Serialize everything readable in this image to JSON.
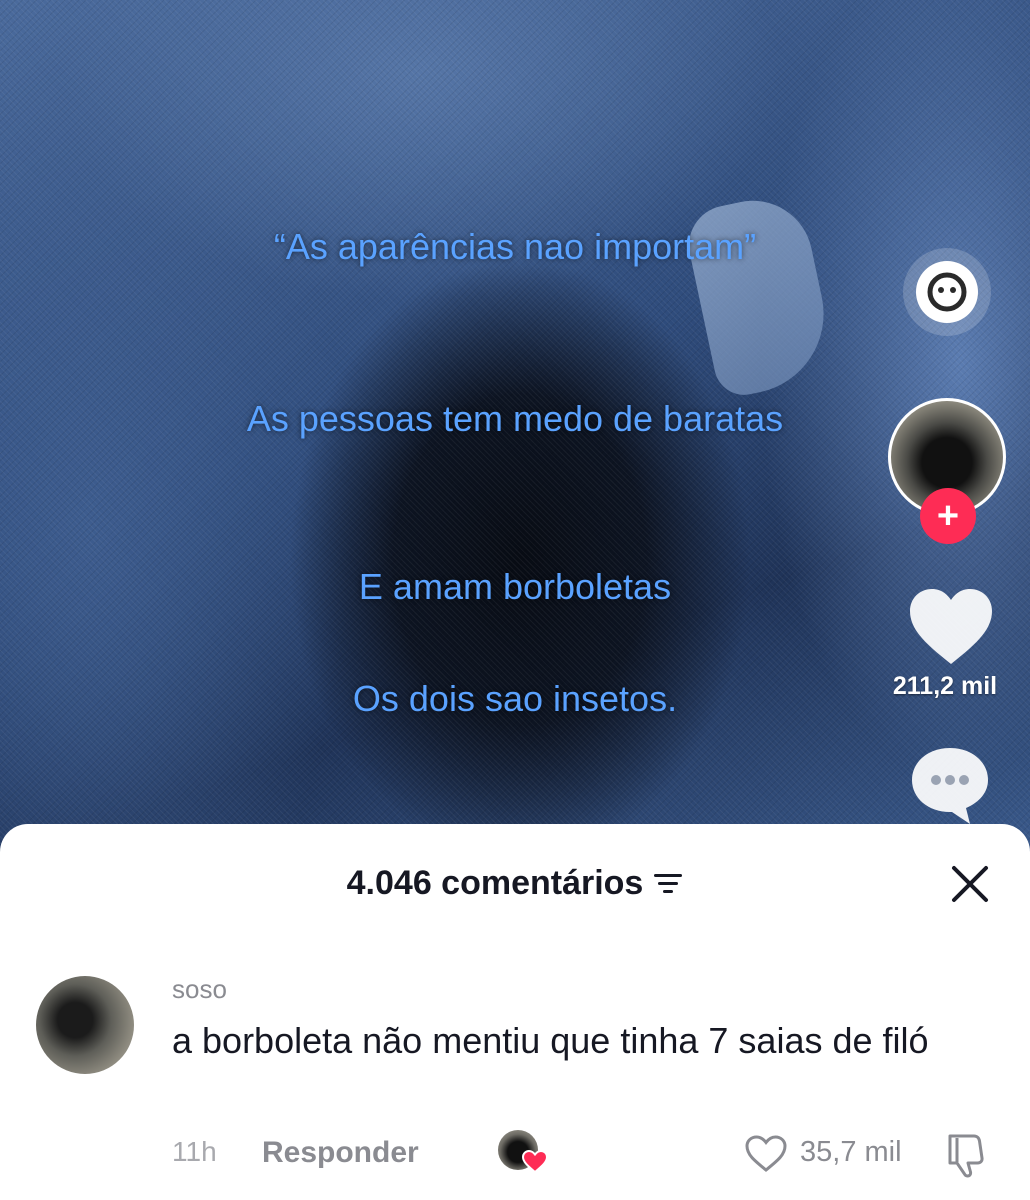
{
  "video": {
    "overlay_lines": [
      "“As aparências nao importam”",
      "As pessoas tem medo de baratas",
      "E amam borboletas",
      "Os dois sao insetos."
    ],
    "text_color": "#5aa2ff"
  },
  "rail": {
    "sticker_icon": "chat-bubble-face-icon",
    "follow_icon": "plus-icon",
    "like_icon": "heart-icon",
    "like_count": "211,2 mil",
    "comment_icon": "comment-bubble-icon"
  },
  "sheet": {
    "title": "4.046 comentários",
    "sort_icon": "sort-icon",
    "close_icon": "close-icon"
  },
  "comment": {
    "user": "soso",
    "text": "a borboleta não mentiu que tinha 7 saias de filó",
    "time": "11h",
    "reply": "Responder",
    "likes": "35,7 mil",
    "liked_by_creator": true,
    "accent": "#fe2c55"
  }
}
